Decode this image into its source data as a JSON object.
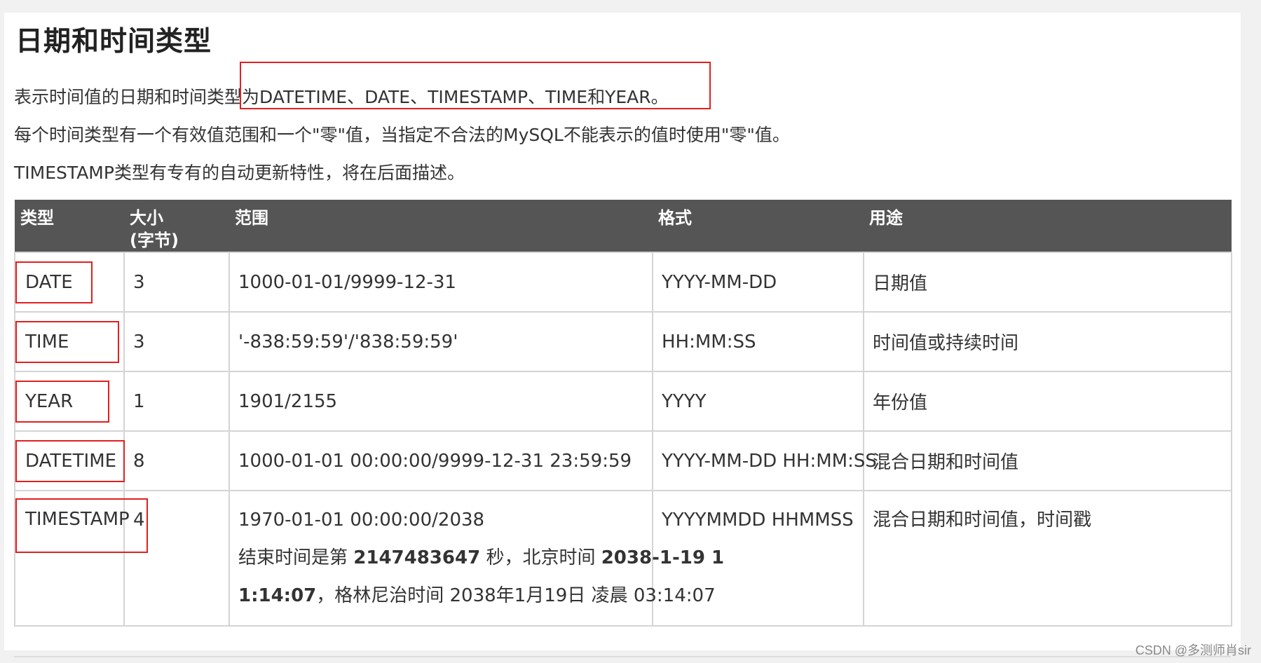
{
  "title": "日期和时间类型",
  "paragraphs": {
    "p1_prefix": "表示时间值的日期和时间类型为",
    "p1_highlight": "DATETIME、DATE、TIMESTAMP、TIME和YEAR。",
    "p2": "每个时间类型有一个有效值范围和一个\"零\"值，当指定不合法的MySQL不能表示的值时使用\"零\"值。",
    "p3": "TIMESTAMP类型有专有的自动更新特性，将在后面描述。"
  },
  "table": {
    "headers": {
      "type": "类型",
      "size_line1": "大小",
      "size_line2": "(字节)",
      "range": "范围",
      "format": "格式",
      "purpose": "用途"
    },
    "rows": [
      {
        "type": "DATE",
        "size": "3",
        "range": "1000-01-01/9999-12-31",
        "format": "YYYY-MM-DD",
        "purpose": "日期值"
      },
      {
        "type": "TIME",
        "size": "3",
        "range": "'-838:59:59'/'838:59:59'",
        "format": "HH:MM:SS",
        "purpose": "时间值或持续时间"
      },
      {
        "type": "YEAR",
        "size": "1",
        "range": "1901/2155",
        "format": "YYYY",
        "purpose": "年份值"
      },
      {
        "type": "DATETIME",
        "size": "8",
        "range": "1000-01-01 00:00:00/9999-12-31 23:59:59",
        "format": "YYYY-MM-DD HH:MM:SS",
        "purpose": "混合日期和时间值"
      }
    ],
    "timestamp_row": {
      "type": "TIMESTAMP",
      "size": "4",
      "range_line1": "1970-01-01 00:00:00/2038",
      "range_l2_a": "结束时间是第 ",
      "range_l2_b": "2147483647",
      "range_l2_c": " 秒，北京时间 ",
      "range_l2_d": "2038-1-19 1",
      "range_l3_a": "1:14:07",
      "range_l3_b": "，格林尼治时间 2038年1月19日 凌晨 03:14:07",
      "format": "YYYYMMDD HHMMSS",
      "purpose": "混合日期和时间值，时间戳"
    }
  },
  "watermark": "CSDN @多测师肖sir"
}
